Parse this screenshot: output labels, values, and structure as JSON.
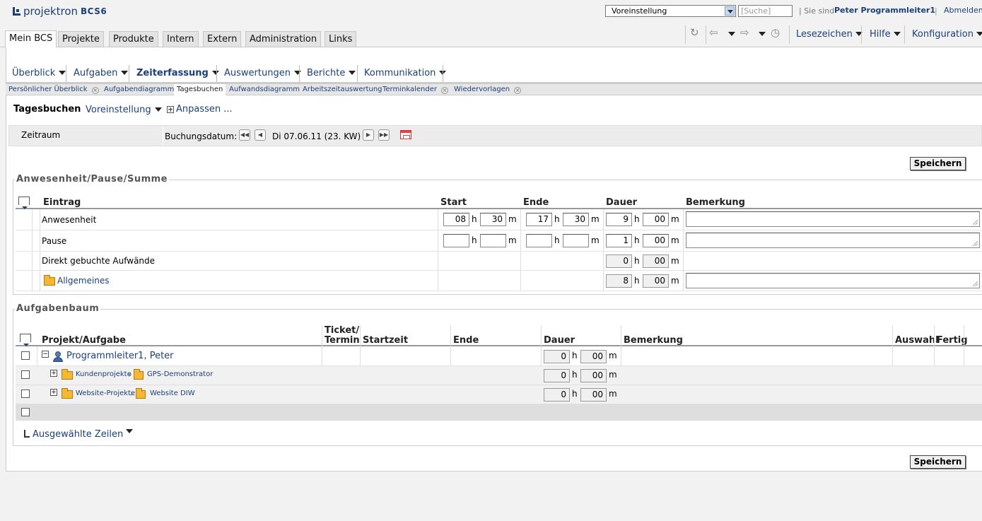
{
  "app": {
    "logo_text": "projektron",
    "logo_product": "BCS",
    "logo_version": "6"
  },
  "header": {
    "preset_select": "Voreinstellung",
    "search_placeholder": "[Suche]",
    "sie_sind": "| Sie sind",
    "user": "Peter Programmleiter1",
    "separator": "|",
    "logout": "Abmelden"
  },
  "main_tabs": [
    "Mein BCS",
    "Projekte",
    "Produkte",
    "Intern",
    "Extern",
    "Administration",
    "Links"
  ],
  "toolbar": {
    "bookmarks": "Lesezeichen",
    "help": "Hilfe",
    "config": "Konfiguration"
  },
  "submenu": [
    "Überblick",
    "Aufgaben",
    "Zeiterfassung",
    "Auswertungen",
    "Berichte",
    "Kommunikation"
  ],
  "subtabs": [
    "Persönlicher Überblick",
    "Aufgabendiagramm",
    "Tagesbuchen",
    "Aufwandsdiagramm",
    "Arbeitszeitauswertung",
    "Terminkalender",
    "Wiedervorlagen"
  ],
  "page": {
    "title": "Tagesbuchen",
    "preset": "Voreinstellung",
    "customize": "Anpassen ..."
  },
  "period": {
    "label": "Zeitraum",
    "date_label": "Buchungsdatum:",
    "date_value": "Di 07.06.11 (23. KW)"
  },
  "save_label": "Speichern",
  "presence": {
    "legend": "Anwesenheit/Pause/Summe",
    "headers": {
      "entry": "Eintrag",
      "start": "Start",
      "end": "Ende",
      "duration": "Dauer",
      "remark": "Bemerkung"
    },
    "unit_h": "h",
    "unit_m": "m",
    "rows": [
      {
        "label": "Anwesenheit",
        "start_h": "08",
        "start_m": "30",
        "end_h": "17",
        "end_m": "30",
        "dur_h": "9",
        "dur_m": "00"
      },
      {
        "label": "Pause",
        "start_h": "",
        "start_m": "",
        "end_h": "",
        "end_m": "",
        "dur_h": "1",
        "dur_m": "00"
      },
      {
        "label": "Direkt gebuchte Aufwände",
        "dur_h": "0",
        "dur_m": "00"
      },
      {
        "label": "Allgemeines",
        "dur_h": "8",
        "dur_m": "00"
      }
    ]
  },
  "tasks": {
    "legend": "Aufgabenbaum",
    "headers": {
      "project": "Projekt/Aufgabe",
      "ticket1": "Ticket/",
      "ticket2": "Termin",
      "start": "Startzeit",
      "end": "Ende",
      "duration": "Dauer",
      "remark": "Bemerkung",
      "select": "Auswahl",
      "done": "Fertig"
    },
    "rows": [
      {
        "label": "Programmleiter1, Peter",
        "dur_h": "0",
        "dur_m": "00"
      },
      {
        "parent": "Kundenprojekte",
        "label": "GPS-Demonstrator",
        "dur_h": "0",
        "dur_m": "00"
      },
      {
        "parent": "Website-Projekte",
        "label": "Website DIW",
        "dur_h": "0",
        "dur_m": "00"
      }
    ],
    "selected_rows": "Ausgewählte Zeilen"
  }
}
